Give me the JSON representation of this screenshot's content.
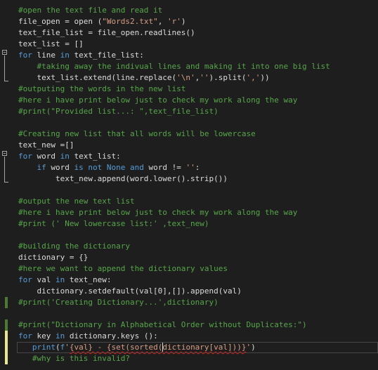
{
  "colors": {
    "background": "#1e1e1e",
    "comment": "#57a64a",
    "keyword": "#569cd6",
    "string": "#d69d85",
    "text": "#dcdcdc",
    "saved_change": "#4e7a2e",
    "unsaved_change": "#e8e88c"
  },
  "lines": [
    [
      [
        "c",
        "#open the text file and read it"
      ]
    ],
    [
      [
        "t",
        "file_open = open ("
      ],
      [
        "s",
        "\"Words2.txt\""
      ],
      [
        "t",
        ", "
      ],
      [
        "s",
        "'r'"
      ],
      [
        "t",
        ")"
      ]
    ],
    [
      [
        "t",
        "text_file_list = file_open.readlines()"
      ]
    ],
    [
      [
        "t",
        "text_list = []"
      ]
    ],
    [
      [
        "k",
        "for"
      ],
      [
        "t",
        " line "
      ],
      [
        "k",
        "in"
      ],
      [
        "t",
        " text_file_list:"
      ]
    ],
    [
      [
        "t",
        "    "
      ],
      [
        "c",
        "#taking away the indivual lines and making it into one big list"
      ]
    ],
    [
      [
        "t",
        "    text_list.extend(line.replace("
      ],
      [
        "s",
        "'\\n'"
      ],
      [
        "t",
        ","
      ],
      [
        "s",
        "''"
      ],
      [
        "t",
        ").split("
      ],
      [
        "s",
        "','"
      ],
      [
        "t",
        "))"
      ]
    ],
    [
      [
        "c",
        "#outputing the words in the new list"
      ]
    ],
    [
      [
        "c",
        "#here i have print below just to check my work along the way"
      ]
    ],
    [
      [
        "c",
        "#print(\"Provided list...: \",text_file_list)"
      ]
    ],
    [],
    [
      [
        "c",
        "#Creating new list that all words will be lowercase"
      ]
    ],
    [
      [
        "t",
        "text_new =[]"
      ]
    ],
    [
      [
        "k",
        "for"
      ],
      [
        "t",
        " word "
      ],
      [
        "k",
        "in"
      ],
      [
        "t",
        " text_list:"
      ]
    ],
    [
      [
        "t",
        "    "
      ],
      [
        "k",
        "if"
      ],
      [
        "t",
        " word "
      ],
      [
        "k",
        "is not None and"
      ],
      [
        "t",
        " word != "
      ],
      [
        "s",
        "''"
      ],
      [
        "t",
        ":"
      ]
    ],
    [
      [
        "t",
        "        text_new.append(word.lower().strip())"
      ]
    ],
    [],
    [
      [
        "c",
        "#output the new text list"
      ]
    ],
    [
      [
        "c",
        "#here i have print below just to check my work along the way"
      ]
    ],
    [
      [
        "c",
        "#print (' New lowercase list:' ,text_new)"
      ]
    ],
    [],
    [
      [
        "c",
        "#building the dictionary"
      ]
    ],
    [
      [
        "t",
        "dictionary = {}"
      ]
    ],
    [
      [
        "c",
        "#here we want to append the dictionary values"
      ]
    ],
    [
      [
        "k",
        "for"
      ],
      [
        "t",
        " val "
      ],
      [
        "k",
        "in"
      ],
      [
        "t",
        " text_new:"
      ]
    ],
    [
      [
        "t",
        "    dictionary.setdefault(val[0],[]).append(val)"
      ]
    ],
    [
      [
        "c",
        "#print('Creating Dictionary...',dictionary)"
      ]
    ],
    [],
    [
      [
        "c",
        "#print(\"Dictionary in Alphabetical Order without Duplicates:\")"
      ]
    ],
    [
      [
        "k",
        "for"
      ],
      [
        "t",
        " key "
      ],
      [
        "k",
        "in"
      ],
      [
        "t",
        " dictionary.keys ():"
      ]
    ],
    [
      [
        "t",
        "   "
      ],
      [
        "k",
        "print"
      ],
      [
        "t",
        "("
      ],
      [
        "k",
        "f"
      ],
      [
        "s",
        "'"
      ],
      [
        "err",
        "{val} - {set(sorted("
      ],
      [
        "caret",
        ""
      ],
      [
        "err",
        "dictionary[val]))}"
      ],
      [
        "s",
        "'"
      ],
      [
        "t",
        ")"
      ]
    ],
    [
      [
        "t",
        "   "
      ],
      [
        "c",
        "#why is this invalid?"
      ]
    ]
  ]
}
